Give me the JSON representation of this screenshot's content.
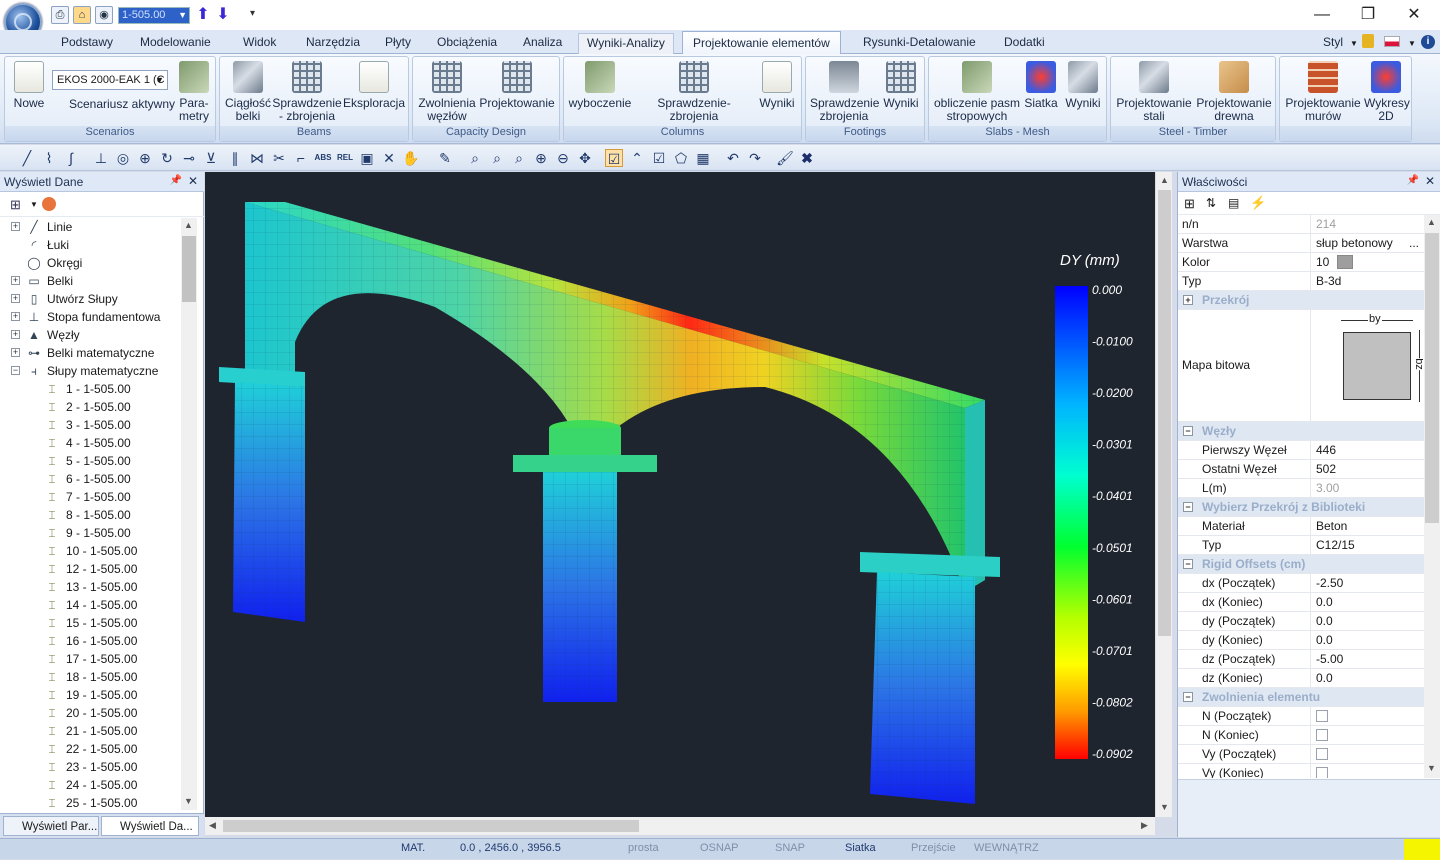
{
  "quick_access": {
    "input_value": "1-505.00"
  },
  "menu": {
    "tabs": [
      "Podstawy",
      "Modelowanie",
      "Widok",
      "Narzędzia",
      "Płyty",
      "Obciążenia",
      "Analiza",
      "Wyniki-Analizy",
      "Projektowanie elementów",
      "Rysunki-Detalowanie",
      "Dodatki"
    ],
    "style_label": "Styl"
  },
  "ribbon": {
    "scenarios": {
      "new_label": "Nowe",
      "select_value": "EKOS 2000-EAK 1 (C",
      "active_label": "Scenariusz aktywny",
      "params_label": "Para-\nmetry",
      "group": "Scenarios"
    },
    "beams": {
      "b1": "Ciągłość\nbelki",
      "b2": "Sprawdzenie\n- zbrojenia",
      "b3": "Eksploracja",
      "group": "Beams"
    },
    "capacity": {
      "b1": "Zwolnienia\nwęzłów",
      "b2": "Projektowanie",
      "group": "Capacity Design"
    },
    "columns": {
      "b1": "wyboczenie",
      "b2": "Sprawdzenie-zbrojenia",
      "b3": "Wyniki",
      "group": "Columns"
    },
    "footings": {
      "b1": "Sprawdzenie\nzbrojenia",
      "b2": "Wyniki",
      "group": "Footings"
    },
    "slabs": {
      "b1": "obliczenie pasm\nstropowych",
      "b2": "Siatka",
      "b3": "Wyniki",
      "group": "Slabs - Mesh"
    },
    "steel": {
      "b1": "Projektowanie\nstali",
      "b2": "Projektowanie\ndrewna",
      "group": "Steel - Timber"
    },
    "masonry": {
      "b1": "Projektowanie\nmurów",
      "b2": "Wykresy\n2D"
    }
  },
  "left_panel": {
    "title": "Wyświetl Dane",
    "tree": [
      {
        "label": "Linie",
        "level": 0,
        "exp": "+",
        "icon": "line-icon"
      },
      {
        "label": "Łuki",
        "level": 0,
        "exp": "",
        "icon": "arc-icon"
      },
      {
        "label": "Okręgi",
        "level": 0,
        "exp": "",
        "icon": "circle-icon"
      },
      {
        "label": "Belki",
        "level": 0,
        "exp": "+",
        "icon": "beam-icon"
      },
      {
        "label": "Utwórz Słupy",
        "level": 0,
        "exp": "+",
        "icon": "column-icon"
      },
      {
        "label": "Stopa fundamentowa",
        "level": 0,
        "exp": "+",
        "icon": "footing-icon"
      },
      {
        "label": "Węzły",
        "level": 0,
        "exp": "+",
        "icon": "node-icon"
      },
      {
        "label": "Belki matematyczne",
        "level": 0,
        "exp": "+",
        "icon": "math-beam-icon"
      },
      {
        "label": "Słupy matematyczne",
        "level": 0,
        "exp": "−",
        "icon": "math-column-icon"
      },
      {
        "label": "1 - 1-505.00",
        "level": 1
      },
      {
        "label": "2 - 1-505.00",
        "level": 1
      },
      {
        "label": "3 - 1-505.00",
        "level": 1
      },
      {
        "label": "4 - 1-505.00",
        "level": 1
      },
      {
        "label": "5 - 1-505.00",
        "level": 1
      },
      {
        "label": "6 - 1-505.00",
        "level": 1
      },
      {
        "label": "7 - 1-505.00",
        "level": 1
      },
      {
        "label": "8 - 1-505.00",
        "level": 1
      },
      {
        "label": "9 - 1-505.00",
        "level": 1
      },
      {
        "label": "10 - 1-505.00",
        "level": 1
      },
      {
        "label": "12 - 1-505.00",
        "level": 1
      },
      {
        "label": "13 - 1-505.00",
        "level": 1
      },
      {
        "label": "14 - 1-505.00",
        "level": 1
      },
      {
        "label": "15 - 1-505.00",
        "level": 1
      },
      {
        "label": "16 - 1-505.00",
        "level": 1
      },
      {
        "label": "17 - 1-505.00",
        "level": 1
      },
      {
        "label": "18 - 1-505.00",
        "level": 1
      },
      {
        "label": "19 - 1-505.00",
        "level": 1
      },
      {
        "label": "20 - 1-505.00",
        "level": 1
      },
      {
        "label": "21 - 1-505.00",
        "level": 1
      },
      {
        "label": "22 - 1-505.00",
        "level": 1
      },
      {
        "label": "23 - 1-505.00",
        "level": 1
      },
      {
        "label": "24 - 1-505.00",
        "level": 1
      },
      {
        "label": "25 - 1-505.00",
        "level": 1
      }
    ],
    "tabs": [
      "Wyświetl Par...",
      "Wyświetl Da..."
    ]
  },
  "viewport": {
    "legend_title": "DY (mm)",
    "legend_values": [
      "0.000",
      "-0.0100",
      "-0.0200",
      "-0.0301",
      "-0.0401",
      "-0.0501",
      "-0.0601",
      "-0.0701",
      "-0.0802",
      "-0.0902"
    ]
  },
  "right_panel": {
    "title": "Właściwości",
    "props": [
      {
        "k": "n/n",
        "v": "214",
        "type": "row",
        "grey": true
      },
      {
        "k": "Warstwa",
        "v": "słup betonowy",
        "type": "row",
        "ellipsis": "..."
      },
      {
        "k": "Kolor",
        "v": "10",
        "type": "color"
      },
      {
        "k": "Typ",
        "v": "B-3d",
        "type": "row"
      },
      {
        "k": "Przekrój",
        "type": "cat",
        "sign": "+"
      },
      {
        "k": "Mapa bitowa",
        "type": "bitmap",
        "by": "by",
        "bz": "bz"
      },
      {
        "k": "Węzły",
        "type": "cat",
        "sign": "−"
      },
      {
        "k": "Pierwszy Węzeł",
        "v": "446",
        "type": "row",
        "ind": true
      },
      {
        "k": "Ostatni Węzeł",
        "v": "502",
        "type": "row",
        "ind": true
      },
      {
        "k": "L(m)",
        "v": "3.00",
        "type": "row",
        "ind": true,
        "grey": true
      },
      {
        "k": "Wybierz Przekrój z Biblioteki",
        "type": "cat",
        "sign": "−"
      },
      {
        "k": "Materiał",
        "v": "Beton",
        "type": "row",
        "ind": true
      },
      {
        "k": "Typ",
        "v": "C12/15",
        "type": "row",
        "ind": true
      },
      {
        "k": "Rigid Offsets (cm)",
        "type": "cat",
        "sign": "−"
      },
      {
        "k": "dx (Początek)",
        "v": "-2.50",
        "type": "row",
        "ind": true
      },
      {
        "k": "dx (Koniec)",
        "v": "0.0",
        "type": "row",
        "ind": true
      },
      {
        "k": "dy (Początek)",
        "v": "0.0",
        "type": "row",
        "ind": true
      },
      {
        "k": "dy (Koniec)",
        "v": "0.0",
        "type": "row",
        "ind": true
      },
      {
        "k": "dz (Początek)",
        "v": "-5.00",
        "type": "row",
        "ind": true
      },
      {
        "k": "dz (Koniec)",
        "v": "0.0",
        "type": "row",
        "ind": true
      },
      {
        "k": "Zwolnienia elementu",
        "type": "cat",
        "sign": "−"
      },
      {
        "k": "N (Początek)",
        "type": "check",
        "ind": true
      },
      {
        "k": "N (Koniec)",
        "type": "check",
        "ind": true
      },
      {
        "k": "Vy (Początek)",
        "type": "check",
        "ind": true
      },
      {
        "k": "Vy (Koniec)",
        "type": "check",
        "ind": true
      }
    ]
  },
  "status": {
    "mat": "MAT.",
    "coords": "0.0 , 2456.0 , 3956.5",
    "items": [
      "prosta",
      "OSNAP",
      "SNAP",
      "Siatka",
      "Przejście",
      "WEWNĄTRZ"
    ]
  },
  "colors": {
    "accent": "#2f62c9",
    "legend_top": "#0000ff",
    "legend_bottom": "#ff0000",
    "status_indicator": "#f5f500"
  }
}
